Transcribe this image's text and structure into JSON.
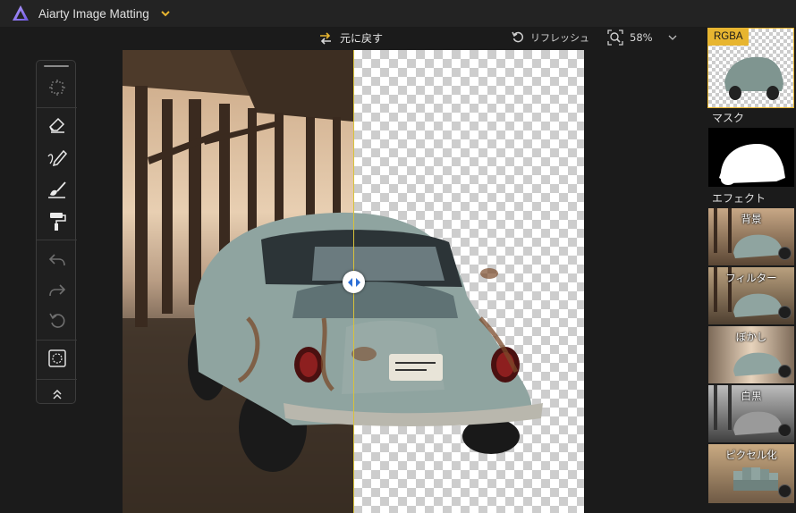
{
  "app": {
    "title": "Aiarty Image Matting",
    "logo_icon": "aiarty-triangle-logo",
    "menu_icon": "chevron-down-icon",
    "accent": "#e7b530"
  },
  "topbar": {
    "undo_all_label": "元に戻す",
    "refresh_label": "リフレッシュ",
    "zoom_value": "58%"
  },
  "toolbox": {
    "tools": [
      "select-region",
      "eraser",
      "brush",
      "fill",
      "roller",
      "undo",
      "redo",
      "reset",
      "mask-view",
      "collapse"
    ]
  },
  "right_panel": {
    "rgba_label": "RGBA",
    "mask_label": "マスク",
    "effects_label": "エフェクト",
    "effects": [
      {
        "label": "背景"
      },
      {
        "label": "フィルター"
      },
      {
        "label": "ぼかし"
      },
      {
        "label": "白黒"
      },
      {
        "label": "ピクセル化"
      }
    ]
  }
}
